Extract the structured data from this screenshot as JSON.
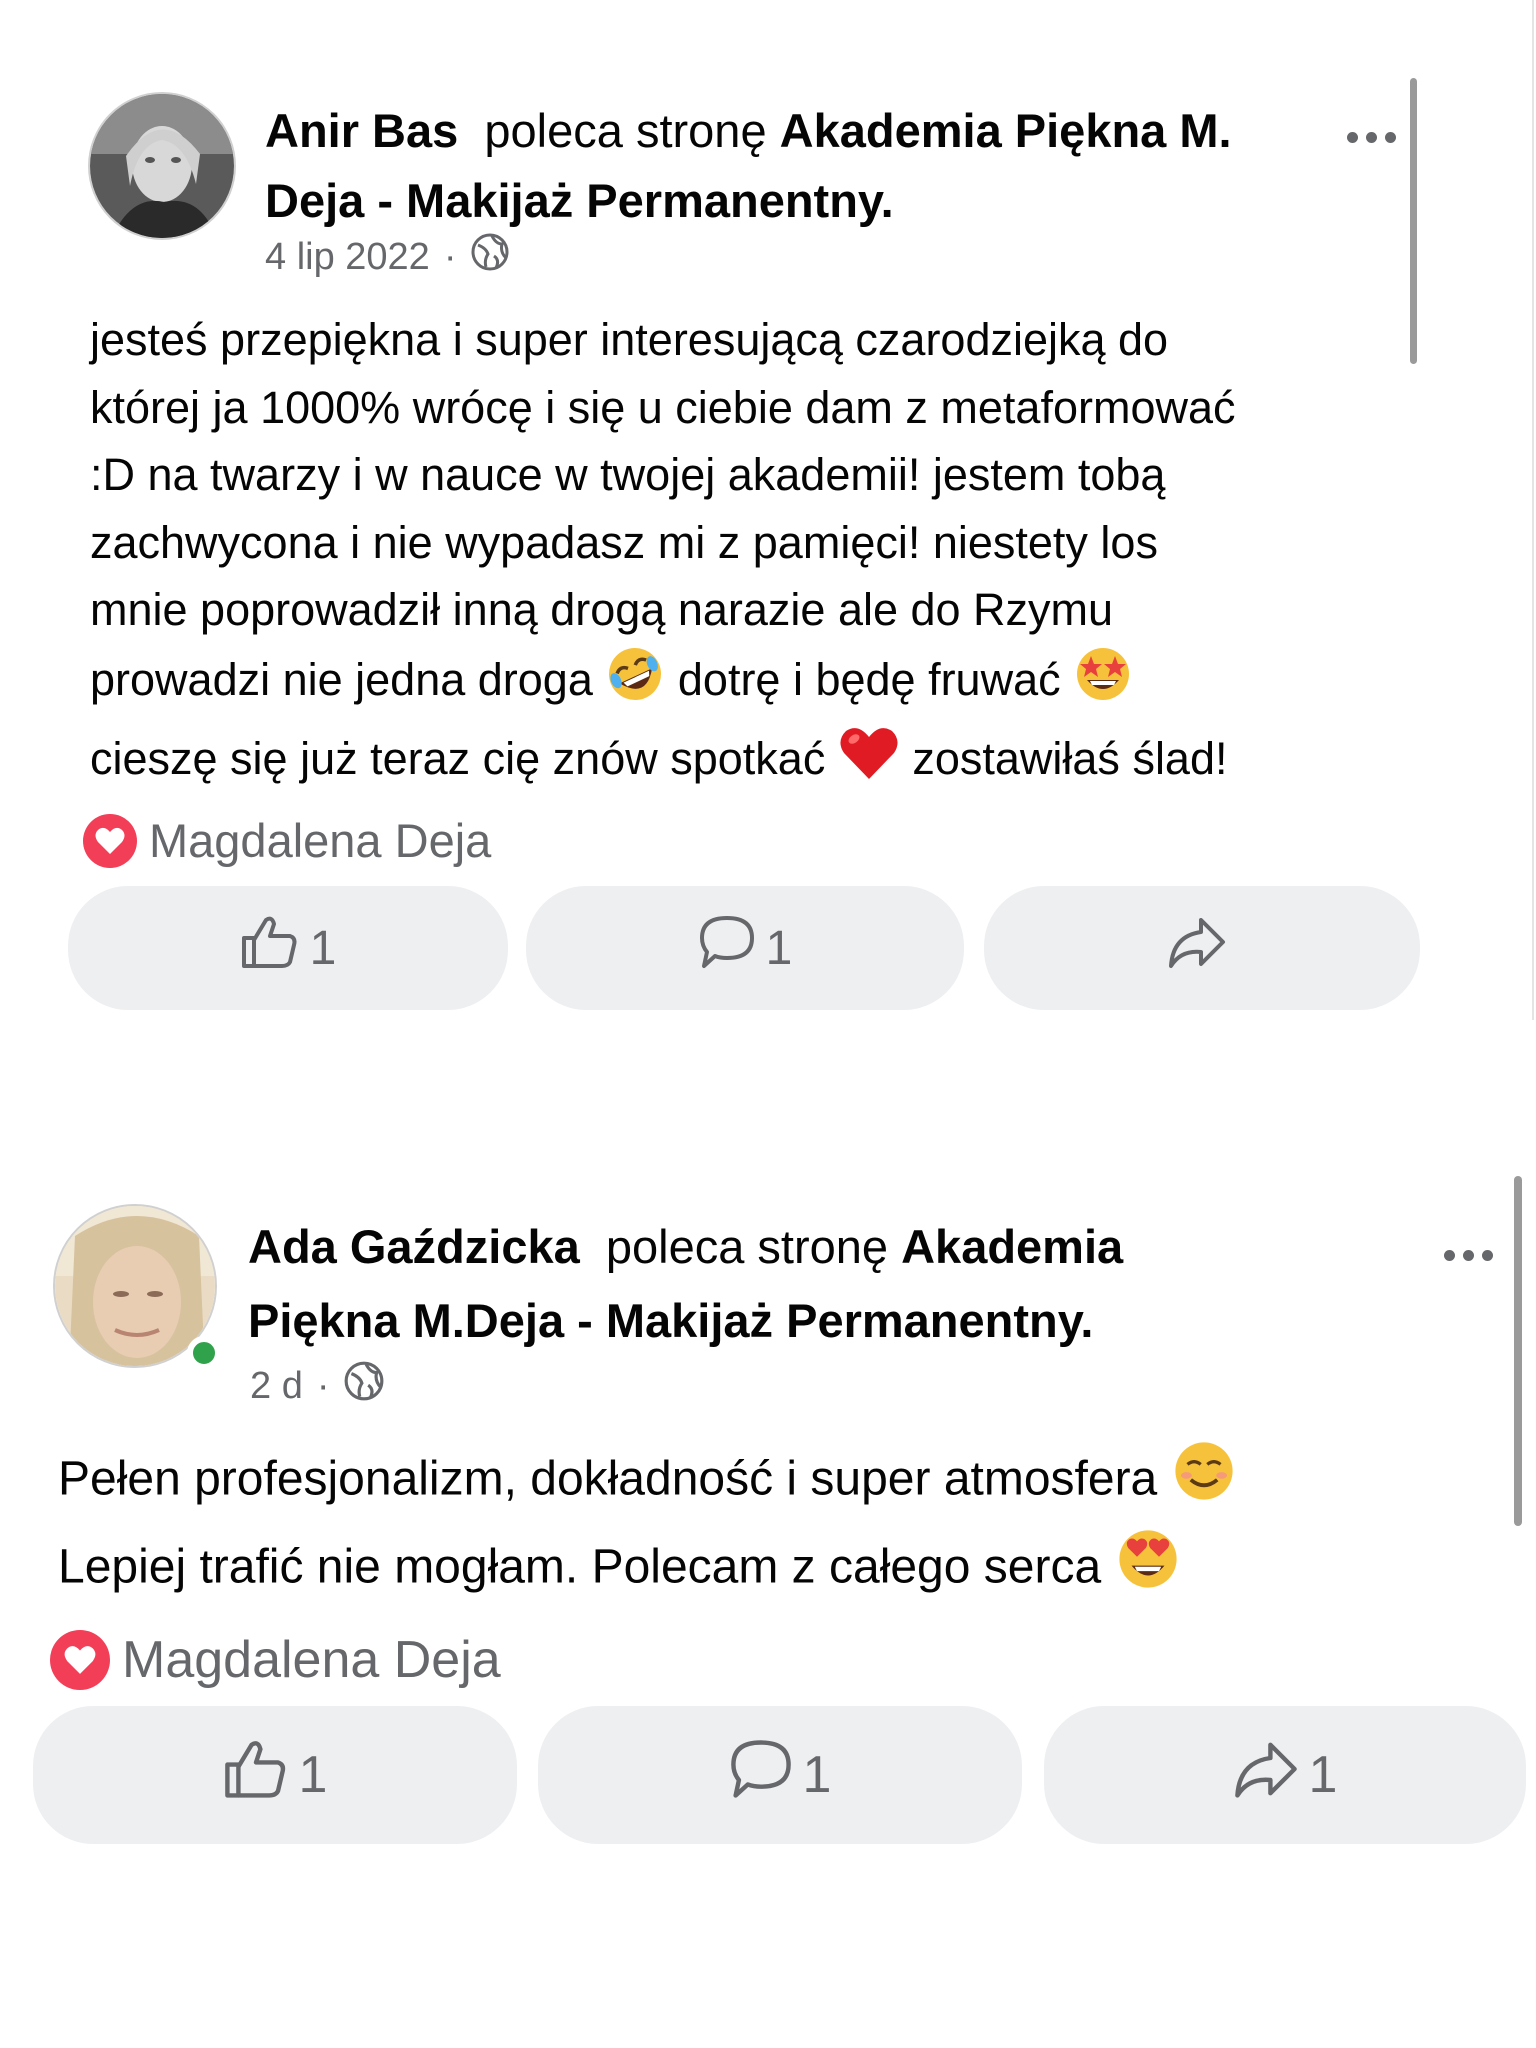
{
  "posts": [
    {
      "author": "Anir Bas",
      "action": "poleca stronę",
      "page_line1": "Akademia Piękna M.",
      "page_line2": "Deja  - Makijaż Permanentny.",
      "date": "4 lip 2022",
      "separator": "·",
      "audience_icon": "globe-icon",
      "body_lines": [
        "jesteś przepiękna i super interesującą czarodziejką do",
        "której ja 1000% wrócę i się u ciebie dam z metaformować",
        ":D na twarzy i w nauce w twojej akademii! jestem tobą",
        "zachwycona i nie wypadasz mi z pamięci! niestety los",
        "mnie poprowadził inną drogą narazie ale do Rzymu"
      ],
      "body_line6_a": "prowadzi nie jedna droga",
      "body_line6_b": "dotrę i będę fruwać",
      "body_line7_a": "cieszę się już teraz cię znów spotkać",
      "body_line7_b": "zostawiłaś ślad!",
      "reacted_by": "Magdalena Deja",
      "like_count": "1",
      "comment_count": "1",
      "share_count": ""
    },
    {
      "author": "Ada Gaździcka",
      "action": "poleca stronę",
      "page_line1": "Akademia",
      "page_line2": "Piękna M.Deja  - Makijaż Permanentny.",
      "date": "2 d",
      "separator": "·",
      "audience_icon": "globe-icon",
      "body_line1": "Pełen profesjonalizm, dokładność i super atmosfera",
      "body_line2": "Lepiej trafić nie mogłam.  Polecam z całego serca",
      "reacted_by": "Magdalena Deja",
      "like_count": "1",
      "comment_count": "1",
      "share_count": "1"
    }
  ],
  "colors": {
    "secondary_text": "#65676b",
    "button_bg": "#eeeff1",
    "heart": "#f33e58",
    "online": "#31a24c"
  }
}
